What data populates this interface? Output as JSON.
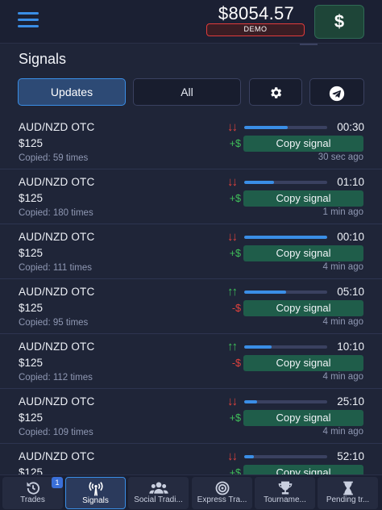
{
  "topbar": {
    "balance": "$8054.57",
    "account_mode": "DEMO",
    "deposit_button": "$",
    "menu_icon": "hamburger-menu-icon"
  },
  "signals": {
    "title": "Signals",
    "tabs": {
      "updates": "Updates",
      "all": "All",
      "settings_icon": "gear-icon",
      "telegram_icon": "telegram-icon"
    },
    "copy_label": "Copy signal",
    "items": [
      {
        "asset": "AUD/NZD OTC",
        "amount": "$125",
        "copied": "Copied: 59 times",
        "direction": "down",
        "arrows": "↓↓",
        "sign": "+$",
        "progress": 0.52,
        "timer": "00:30",
        "ago": "30 sec ago"
      },
      {
        "asset": "AUD/NZD OTC",
        "amount": "$125",
        "copied": "Copied: 180 times",
        "direction": "down",
        "arrows": "↓↓",
        "sign": "+$",
        "progress": 0.36,
        "timer": "01:10",
        "ago": "1 min ago"
      },
      {
        "asset": "AUD/NZD OTC",
        "amount": "$125",
        "copied": "Copied: 111 times",
        "direction": "down",
        "arrows": "↓↓",
        "sign": "+$",
        "progress": 1.0,
        "timer": "00:10",
        "ago": "4 min ago"
      },
      {
        "asset": "AUD/NZD OTC",
        "amount": "$125",
        "copied": "Copied: 95 times",
        "direction": "up",
        "arrows": "↑↑",
        "sign": "-$",
        "progress": 0.5,
        "timer": "05:10",
        "ago": "4 min ago"
      },
      {
        "asset": "AUD/NZD OTC",
        "amount": "$125",
        "copied": "Copied: 112 times",
        "direction": "up",
        "arrows": "↑↑",
        "sign": "-$",
        "progress": 0.33,
        "timer": "10:10",
        "ago": "4 min ago"
      },
      {
        "asset": "AUD/NZD OTC",
        "amount": "$125",
        "copied": "Copied: 109 times",
        "direction": "down",
        "arrows": "↓↓",
        "sign": "+$",
        "progress": 0.16,
        "timer": "25:10",
        "ago": "4 min ago"
      },
      {
        "asset": "AUD/NZD OTC",
        "amount": "$125",
        "copied": "",
        "direction": "down",
        "arrows": "↓↓",
        "sign": "+$",
        "progress": 0.12,
        "timer": "52:10",
        "ago": ""
      }
    ]
  },
  "bottom_nav": {
    "trades_badge": "1",
    "items": [
      {
        "label": "Trades",
        "icon": "history-icon",
        "active": false
      },
      {
        "label": "Signals",
        "icon": "signal-tower-icon",
        "active": true
      },
      {
        "label": "Social Tradi...",
        "icon": "users-icon",
        "active": false
      },
      {
        "label": "Express Tra...",
        "icon": "target-icon",
        "active": false
      },
      {
        "label": "Tourname...",
        "icon": "trophy-icon",
        "active": false
      },
      {
        "label": "Pending tr...",
        "icon": "hourglass-icon",
        "active": false
      }
    ]
  },
  "colors": {
    "background": "#1f2538",
    "accent": "#3a8ee6",
    "down": "#e0423d",
    "up": "#3fbf5a",
    "copy_button": "#1f5d4a"
  }
}
